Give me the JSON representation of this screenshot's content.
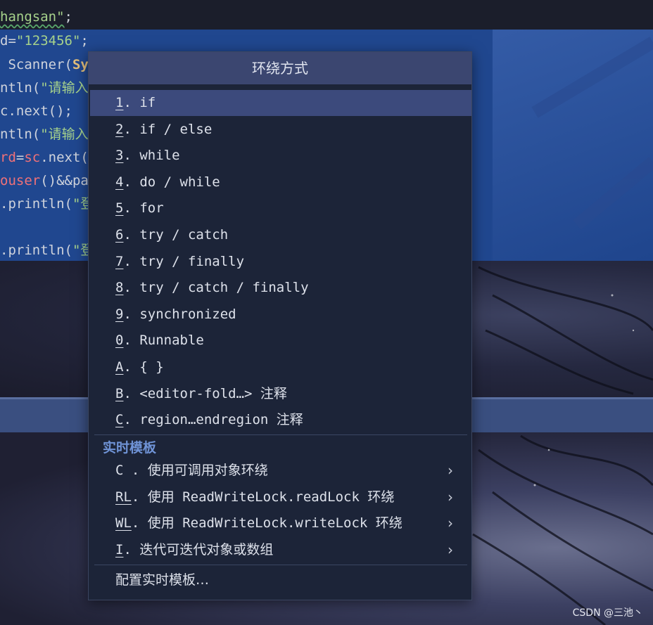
{
  "editor": {
    "lines": [
      {
        "pre": "",
        "str": "hangsan\"",
        "post": ";"
      },
      {
        "pre": "d=",
        "str": "\"123456\"",
        "post": ";"
      },
      {
        "pre": " Scanner(",
        "cls": "Sy",
        "post": ""
      },
      {
        "pre": "ntln(",
        "str": "\"请输入",
        "post": ""
      },
      {
        "pre": "c.next();",
        "post": ""
      },
      {
        "pre": "ntln(",
        "str": "\"请输入",
        "post": ""
      },
      {
        "var": "rd",
        "pre": "=",
        "var2": "sc",
        "post": ".next("
      },
      {
        "pre": "(",
        "var": "ouser",
        "post": ")&&pa"
      },
      {
        "pre": ".println(",
        "str": "\"登",
        "post": ""
      },
      {
        "pre": "",
        "post": ""
      },
      {
        "pre": ".println(",
        "str": "\"登",
        "post": ""
      }
    ]
  },
  "popup": {
    "title": "环绕方式",
    "items": [
      {
        "key": "1",
        "rest": ". if"
      },
      {
        "key": "2",
        "rest": ". if / else"
      },
      {
        "key": "3",
        "rest": ". while"
      },
      {
        "key": "4",
        "rest": ". do / while"
      },
      {
        "key": "5",
        "rest": ". for"
      },
      {
        "key": "6",
        "rest": ". try / catch"
      },
      {
        "key": "7",
        "rest": ". try / finally"
      },
      {
        "key": "8",
        "rest": ". try / catch / finally"
      },
      {
        "key": "9",
        "rest": ". synchronized"
      },
      {
        "key": "0",
        "rest": ". Runnable"
      },
      {
        "key": "A",
        "rest": ". { }"
      },
      {
        "key": "B",
        "rest": ". <editor-fold…> ",
        "cn": "注释"
      },
      {
        "key": "C",
        "rest": ". region…endregion ",
        "cn": "注释"
      }
    ],
    "live_templates_label": "实时模板",
    "live_templates": [
      {
        "key": "",
        "prefix": "C .",
        "rest": " ",
        "cn": "使用可调用对象环绕"
      },
      {
        "key": "RL",
        "prefix": "",
        "rest": ". ",
        "cn": "使用",
        "mono": " ReadWriteLock.readLock ",
        "cn2": "环绕"
      },
      {
        "key": "WL",
        "prefix": "",
        "rest": ". ",
        "cn": "使用",
        "mono": " ReadWriteLock.writeLock ",
        "cn2": "环绕"
      },
      {
        "key": "I",
        "prefix": "",
        "rest": ". ",
        "cn": "迭代可迭代对象或数组"
      }
    ],
    "chevron": "›",
    "configure_label": "配置实时模板…"
  },
  "watermark": "CSDN @三池丶",
  "colors": {
    "accent": "#3c4a7c",
    "section": "#6f93d6",
    "selection": "#20478f"
  }
}
